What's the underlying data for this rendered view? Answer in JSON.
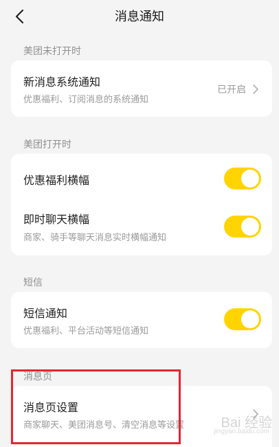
{
  "header": {
    "title": "消息通知",
    "back_icon": "chevron-left-icon"
  },
  "sections": {
    "closed": {
      "label": "美团未打开时",
      "rows": [
        {
          "title": "新消息系统通知",
          "subtitle": "优惠福利、订阅消息的系统通知",
          "status": "已开启"
        }
      ]
    },
    "open": {
      "label": "美团打开时",
      "rows": [
        {
          "title": "优惠福利横幅",
          "toggle_on": true
        },
        {
          "title": "即时聊天横幅",
          "subtitle": "商家、骑手等聊天消息实时横幅通知",
          "toggle_on": true
        }
      ]
    },
    "sms": {
      "label": "短信",
      "rows": [
        {
          "title": "短信通知",
          "subtitle": "优惠福利、平台活动等短信通知",
          "toggle_on": true
        }
      ]
    },
    "message_page": {
      "label": "消息页",
      "rows": [
        {
          "title": "消息页设置",
          "subtitle": "商家聊天、美团消息号、清空消息等设置"
        }
      ]
    }
  },
  "colors": {
    "toggle_on": "#ffd400",
    "highlight": "#e8242c",
    "background": "#f4f4f4"
  },
  "watermark": {
    "main": "Bai 经验",
    "sub": "jingyan.baidu.com"
  }
}
